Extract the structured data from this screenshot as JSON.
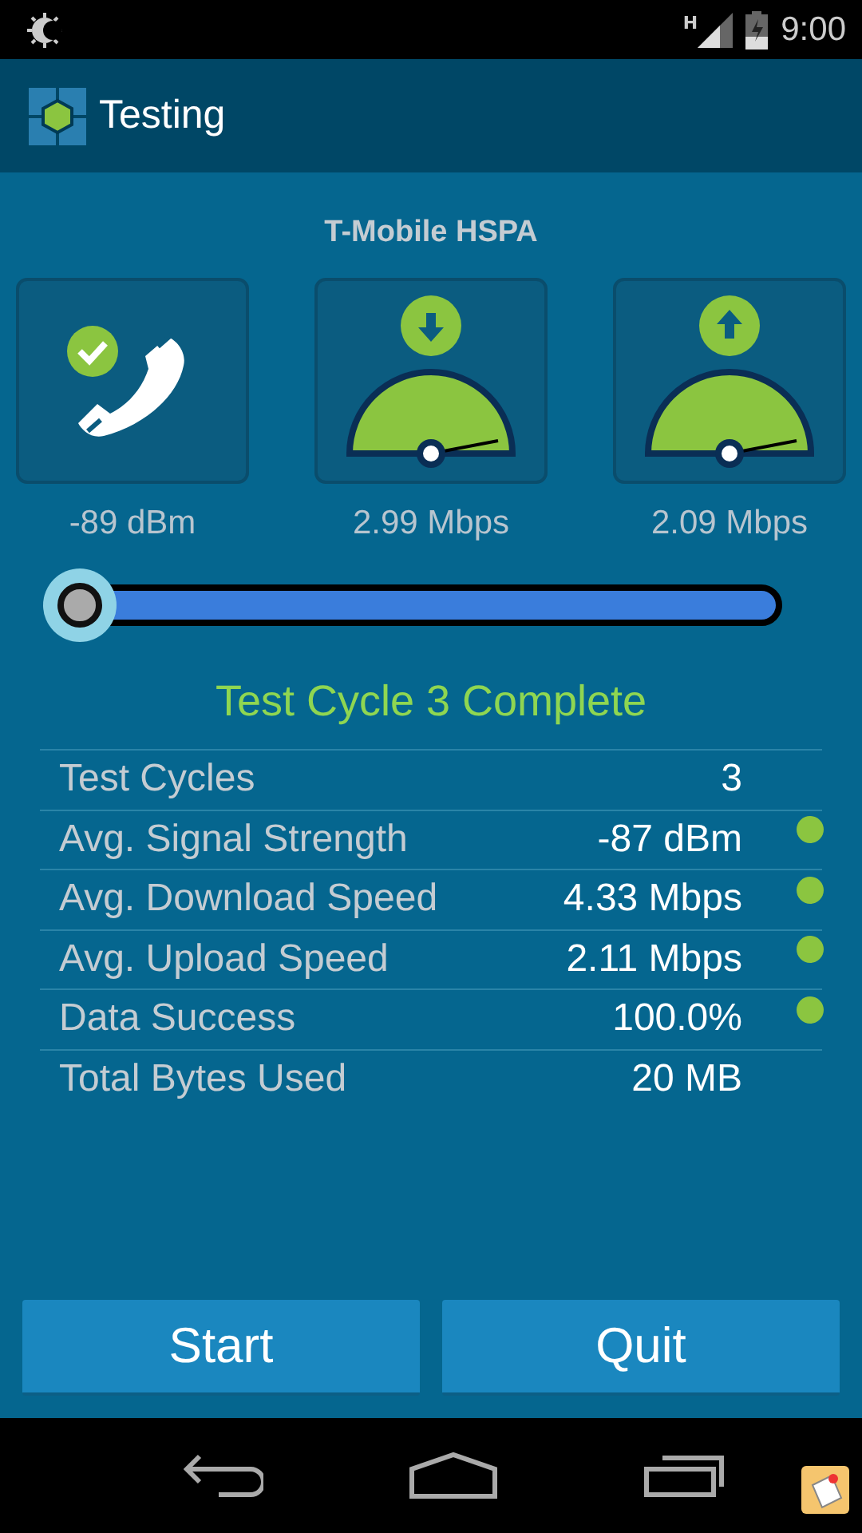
{
  "status_bar": {
    "time": "9:00",
    "network": "H"
  },
  "app_bar": {
    "title": "Testing"
  },
  "carrier": "T-Mobile HSPA",
  "tiles": [
    {
      "kind": "signal",
      "reading": "-89 dBm"
    },
    {
      "kind": "download",
      "reading": "2.99 Mbps"
    },
    {
      "kind": "upload",
      "reading": "2.09 Mbps"
    }
  ],
  "result": "Test Cycle 3 Complete",
  "stats": [
    {
      "label": "Test Cycles",
      "value": "3",
      "ok": false
    },
    {
      "label": "Avg. Signal Strength",
      "value": "-87 dBm",
      "ok": true
    },
    {
      "label": "Avg. Download Speed",
      "value": "4.33 Mbps",
      "ok": true
    },
    {
      "label": "Avg. Upload Speed",
      "value": "2.11 Mbps",
      "ok": true
    },
    {
      "label": "Data Success",
      "value": "100.0%",
      "ok": true
    },
    {
      "label": "Total Bytes Used",
      "value": "20 MB",
      "ok": false
    }
  ],
  "buttons": [
    {
      "label": "Start"
    },
    {
      "label": "Quit"
    }
  ]
}
